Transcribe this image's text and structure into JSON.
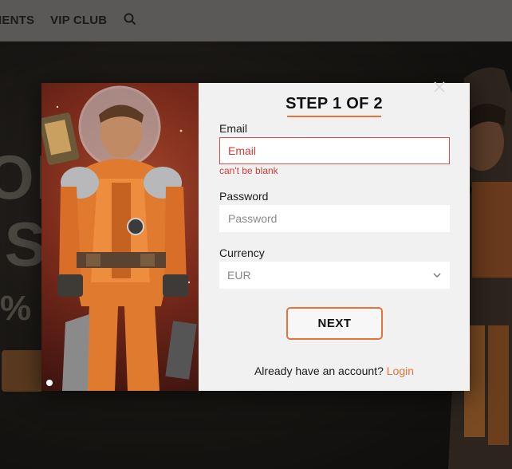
{
  "nav": {
    "items": [
      {
        "label": "IENTS"
      },
      {
        "label": "VIP CLUB"
      }
    ],
    "search_icon": "search-icon"
  },
  "hero": {
    "letters": "ON\nIS",
    "percent": "%"
  },
  "modal": {
    "step_title": "STEP 1 OF 2",
    "email": {
      "label": "Email",
      "placeholder": "Email",
      "error": "can't be blank"
    },
    "password": {
      "label": "Password",
      "placeholder": "Password"
    },
    "currency": {
      "label": "Currency",
      "selected": "EUR"
    },
    "next_label": "NEXT",
    "login_prompt": "Already have an account?",
    "login_link": "Login",
    "close_icon": "close-icon"
  },
  "colors": {
    "accent": "#e8733a",
    "error": "#d83c3c",
    "nav_bg": "#5a5958",
    "modal_bg": "#f1f1f1"
  }
}
